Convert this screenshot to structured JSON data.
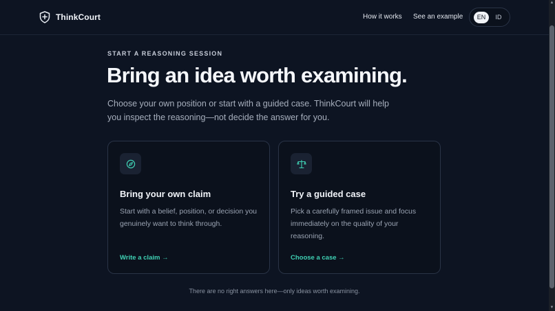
{
  "header": {
    "brand_name": "ThinkCourt",
    "brand_icon": "shield-plus-icon",
    "nav": [
      {
        "label": "How it works"
      },
      {
        "label": "See an example"
      }
    ],
    "languages": [
      {
        "code": "EN",
        "active": true
      },
      {
        "code": "ID",
        "active": false
      }
    ]
  },
  "intro": {
    "eyebrow": "START A REASONING SESSION",
    "title": "Bring an idea worth examining.",
    "description": "Choose your own position or start with a guided case. ThinkCourt will help you inspect the reasoning—not decide the answer for you."
  },
  "cards": [
    {
      "icon": "compass-icon",
      "title": "Bring your own claim",
      "description": "Start with a belief, position, or decision you genuinely want to think through.",
      "link": "Write a claim →"
    },
    {
      "icon": "scales-icon",
      "title": "Try a guided case",
      "description": "Pick a carefully framed issue and focus immediately on the quality of your reasoning.",
      "link": "Choose a case →"
    }
  ],
  "footnote": "There are no right answers here—only ideas worth examining.",
  "colors": {
    "background": "#0d1422",
    "card_background": "#0b111c",
    "accent": "#3fd1b4",
    "border": "#2a3447"
  }
}
